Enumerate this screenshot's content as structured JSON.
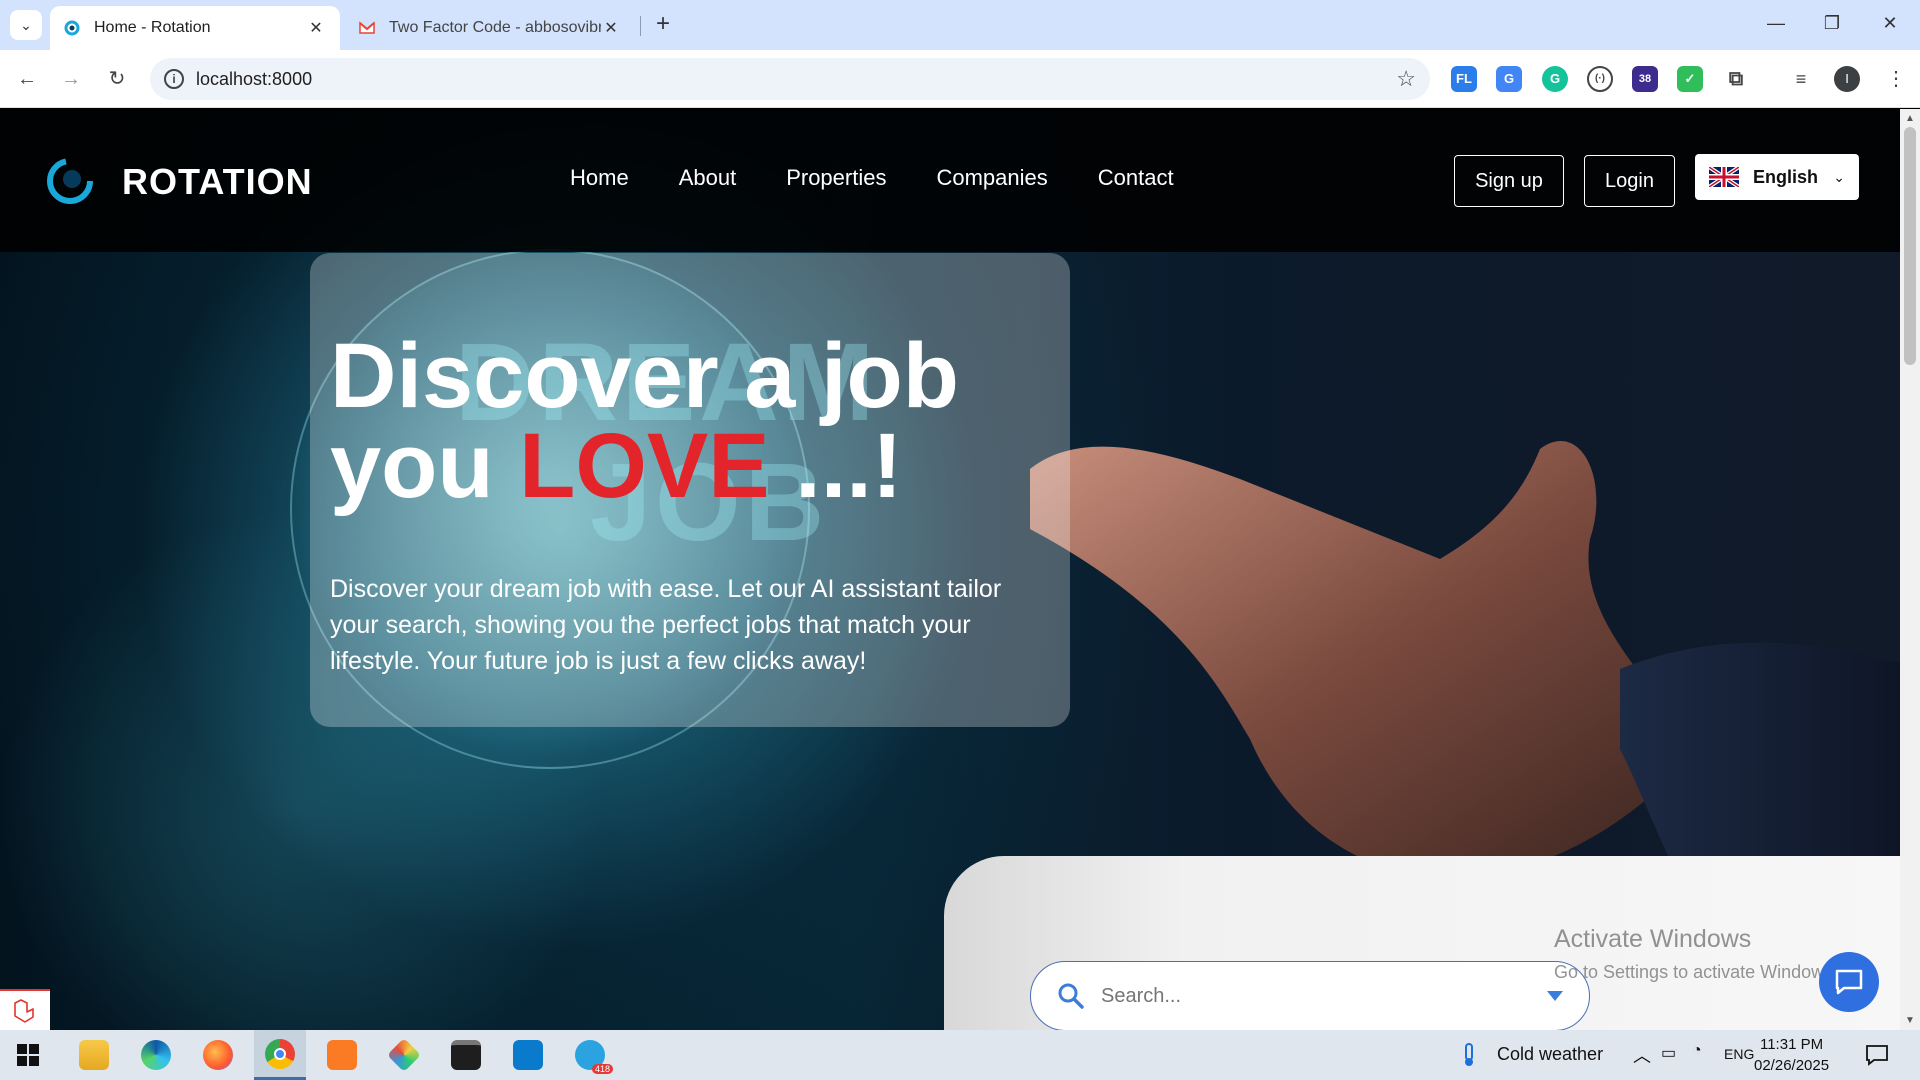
{
  "browser": {
    "tabs": [
      {
        "title": "Home - Rotation",
        "active": true
      },
      {
        "title": "Two Factor Code - abbosovibro",
        "active": false
      }
    ],
    "url": "localhost:8000",
    "extensions": [
      {
        "name": "fl-extension-icon",
        "label": "FL",
        "color": "#2b7de9"
      },
      {
        "name": "translate-icon",
        "label": "G",
        "color": "#4285f4"
      },
      {
        "name": "grammarly-icon",
        "label": "G",
        "color": "#15c39a"
      },
      {
        "name": "dev-tools-icon",
        "label": "(·)",
        "color": "#555555"
      },
      {
        "name": "graduation-cap-icon",
        "label": "38",
        "color": "#3d2c8d"
      },
      {
        "name": "shield-check-icon",
        "label": "✓",
        "color": "#2fbe5a"
      },
      {
        "name": "extensions-puzzle-icon",
        "label": "",
        "color": "#444444"
      },
      {
        "name": "media-controls-icon",
        "label": "",
        "color": "#444444"
      }
    ],
    "profile_initial": "I"
  },
  "site": {
    "brand": "ROTATION",
    "nav": [
      "Home",
      "About",
      "Properties",
      "Companies",
      "Contact"
    ],
    "signup_label": "Sign up",
    "login_label": "Login",
    "language": "English"
  },
  "hero": {
    "title_line1": "Discover a job",
    "title_you": "you ",
    "title_love": "LOVE",
    "title_end": " ...!",
    "bg_word1": "DREAM",
    "bg_word2": "JOB",
    "description": "Discover your dream job with ease. Let our AI assistant tailor your search, showing you the perfect jobs that match your lifestyle. Your future job is just a few clicks away!"
  },
  "search": {
    "placeholder": "Search..."
  },
  "watermark": {
    "line1": "Activate Windows",
    "line2": "Go to Settings to activate Windows."
  },
  "taskbar": {
    "apps": [
      {
        "name": "start-button",
        "active": false
      },
      {
        "name": "file-explorer-icon",
        "active": false
      },
      {
        "name": "edge-icon",
        "active": false
      },
      {
        "name": "firefox-icon",
        "active": false
      },
      {
        "name": "chrome-icon",
        "active": true
      },
      {
        "name": "xampp-icon",
        "active": false
      },
      {
        "name": "git-icon",
        "active": false
      },
      {
        "name": "terminal-icon",
        "active": false
      },
      {
        "name": "vscode-icon",
        "active": false
      },
      {
        "name": "telegram-icon",
        "active": false
      }
    ],
    "telegram_badge": "418",
    "weather": "Cold weather",
    "lang": "ENG",
    "time": "11:31 PM",
    "date": "02/26/2025"
  },
  "colors": {
    "accent_love": "#e3242b",
    "tabbar": "#d3e3fd",
    "chat": "#2f6fe0"
  }
}
